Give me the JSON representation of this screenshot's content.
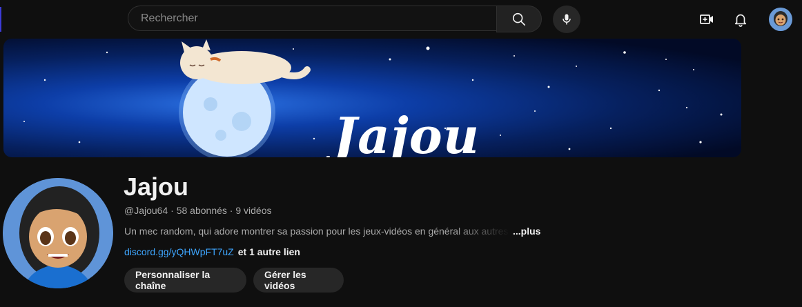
{
  "search": {
    "placeholder": "Rechercher"
  },
  "banner": {
    "title": "Jajou"
  },
  "channel": {
    "name": "Jajou",
    "handle": "@Jajou64",
    "subscribers": "58 abonnés",
    "videos": "9 vidéos",
    "separator": " · ",
    "description": "Un mec random, qui adore montrer sa passion pour les jeux-vidéos en général aux autres à",
    "more_label": "...plus",
    "link": "discord.gg/yQHWpFT7uZ",
    "other_links": "et 1 autre lien"
  },
  "actions": {
    "customize_label": "Personnaliser la chaîne",
    "manage_label": "Gérer les vidéos"
  },
  "icons": [
    "search-icon",
    "mic-icon",
    "create-icon",
    "notifications-icon",
    "avatar"
  ]
}
